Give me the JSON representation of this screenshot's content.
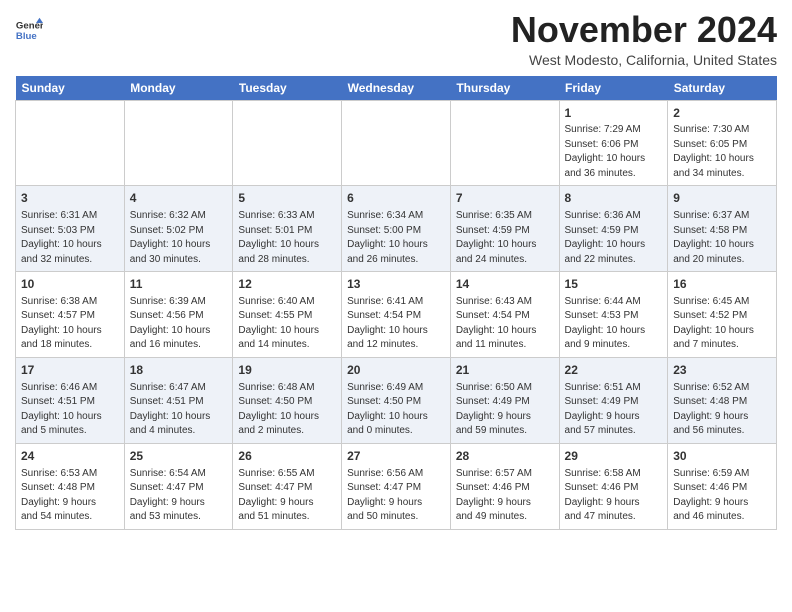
{
  "header": {
    "title": "November 2024",
    "subtitle": "West Modesto, California, United States",
    "logo_line1": "General",
    "logo_line2": "Blue"
  },
  "days_of_week": [
    "Sunday",
    "Monday",
    "Tuesday",
    "Wednesday",
    "Thursday",
    "Friday",
    "Saturday"
  ],
  "weeks": [
    [
      {
        "day": "",
        "info": ""
      },
      {
        "day": "",
        "info": ""
      },
      {
        "day": "",
        "info": ""
      },
      {
        "day": "",
        "info": ""
      },
      {
        "day": "",
        "info": ""
      },
      {
        "day": "1",
        "info": "Sunrise: 7:29 AM\nSunset: 6:06 PM\nDaylight: 10 hours\nand 36 minutes."
      },
      {
        "day": "2",
        "info": "Sunrise: 7:30 AM\nSunset: 6:05 PM\nDaylight: 10 hours\nand 34 minutes."
      }
    ],
    [
      {
        "day": "3",
        "info": "Sunrise: 6:31 AM\nSunset: 5:03 PM\nDaylight: 10 hours\nand 32 minutes."
      },
      {
        "day": "4",
        "info": "Sunrise: 6:32 AM\nSunset: 5:02 PM\nDaylight: 10 hours\nand 30 minutes."
      },
      {
        "day": "5",
        "info": "Sunrise: 6:33 AM\nSunset: 5:01 PM\nDaylight: 10 hours\nand 28 minutes."
      },
      {
        "day": "6",
        "info": "Sunrise: 6:34 AM\nSunset: 5:00 PM\nDaylight: 10 hours\nand 26 minutes."
      },
      {
        "day": "7",
        "info": "Sunrise: 6:35 AM\nSunset: 4:59 PM\nDaylight: 10 hours\nand 24 minutes."
      },
      {
        "day": "8",
        "info": "Sunrise: 6:36 AM\nSunset: 4:59 PM\nDaylight: 10 hours\nand 22 minutes."
      },
      {
        "day": "9",
        "info": "Sunrise: 6:37 AM\nSunset: 4:58 PM\nDaylight: 10 hours\nand 20 minutes."
      }
    ],
    [
      {
        "day": "10",
        "info": "Sunrise: 6:38 AM\nSunset: 4:57 PM\nDaylight: 10 hours\nand 18 minutes."
      },
      {
        "day": "11",
        "info": "Sunrise: 6:39 AM\nSunset: 4:56 PM\nDaylight: 10 hours\nand 16 minutes."
      },
      {
        "day": "12",
        "info": "Sunrise: 6:40 AM\nSunset: 4:55 PM\nDaylight: 10 hours\nand 14 minutes."
      },
      {
        "day": "13",
        "info": "Sunrise: 6:41 AM\nSunset: 4:54 PM\nDaylight: 10 hours\nand 12 minutes."
      },
      {
        "day": "14",
        "info": "Sunrise: 6:43 AM\nSunset: 4:54 PM\nDaylight: 10 hours\nand 11 minutes."
      },
      {
        "day": "15",
        "info": "Sunrise: 6:44 AM\nSunset: 4:53 PM\nDaylight: 10 hours\nand 9 minutes."
      },
      {
        "day": "16",
        "info": "Sunrise: 6:45 AM\nSunset: 4:52 PM\nDaylight: 10 hours\nand 7 minutes."
      }
    ],
    [
      {
        "day": "17",
        "info": "Sunrise: 6:46 AM\nSunset: 4:51 PM\nDaylight: 10 hours\nand 5 minutes."
      },
      {
        "day": "18",
        "info": "Sunrise: 6:47 AM\nSunset: 4:51 PM\nDaylight: 10 hours\nand 4 minutes."
      },
      {
        "day": "19",
        "info": "Sunrise: 6:48 AM\nSunset: 4:50 PM\nDaylight: 10 hours\nand 2 minutes."
      },
      {
        "day": "20",
        "info": "Sunrise: 6:49 AM\nSunset: 4:50 PM\nDaylight: 10 hours\nand 0 minutes."
      },
      {
        "day": "21",
        "info": "Sunrise: 6:50 AM\nSunset: 4:49 PM\nDaylight: 9 hours\nand 59 minutes."
      },
      {
        "day": "22",
        "info": "Sunrise: 6:51 AM\nSunset: 4:49 PM\nDaylight: 9 hours\nand 57 minutes."
      },
      {
        "day": "23",
        "info": "Sunrise: 6:52 AM\nSunset: 4:48 PM\nDaylight: 9 hours\nand 56 minutes."
      }
    ],
    [
      {
        "day": "24",
        "info": "Sunrise: 6:53 AM\nSunset: 4:48 PM\nDaylight: 9 hours\nand 54 minutes."
      },
      {
        "day": "25",
        "info": "Sunrise: 6:54 AM\nSunset: 4:47 PM\nDaylight: 9 hours\nand 53 minutes."
      },
      {
        "day": "26",
        "info": "Sunrise: 6:55 AM\nSunset: 4:47 PM\nDaylight: 9 hours\nand 51 minutes."
      },
      {
        "day": "27",
        "info": "Sunrise: 6:56 AM\nSunset: 4:47 PM\nDaylight: 9 hours\nand 50 minutes."
      },
      {
        "day": "28",
        "info": "Sunrise: 6:57 AM\nSunset: 4:46 PM\nDaylight: 9 hours\nand 49 minutes."
      },
      {
        "day": "29",
        "info": "Sunrise: 6:58 AM\nSunset: 4:46 PM\nDaylight: 9 hours\nand 47 minutes."
      },
      {
        "day": "30",
        "info": "Sunrise: 6:59 AM\nSunset: 4:46 PM\nDaylight: 9 hours\nand 46 minutes."
      }
    ]
  ]
}
